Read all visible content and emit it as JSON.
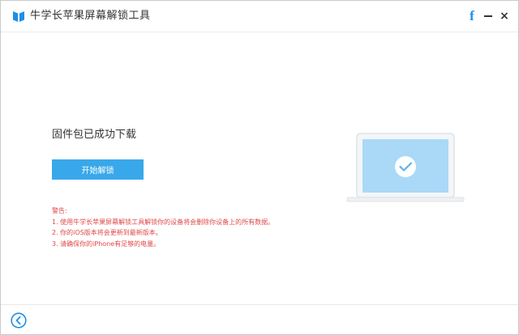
{
  "app": {
    "title": "牛学长苹果屏幕解锁工具",
    "accent_color": "#38a8ea",
    "logo_icon": "brand-logo-icon"
  },
  "window_controls": {
    "facebook_glyph": "f",
    "minimize_icon": "minimize-icon",
    "close_glyph": "×"
  },
  "main": {
    "status_title": "固件包已成功下载",
    "start_button_label": "开始解锁",
    "warning": {
      "heading": "警告:",
      "items": [
        "1. 使用牛学长苹果屏幕解锁工具解锁你的设备将会删除你设备上的所有数据。",
        "2. 你的iOS版本将会更新到最新版本。",
        "3. 请确保你的iPhone有足够的电量。"
      ],
      "color": "#e04848"
    },
    "illustration": {
      "icon": "laptop-check-icon",
      "screen_color": "#a9d9f7"
    }
  },
  "footer": {
    "back_icon": "back-arrow-icon"
  }
}
